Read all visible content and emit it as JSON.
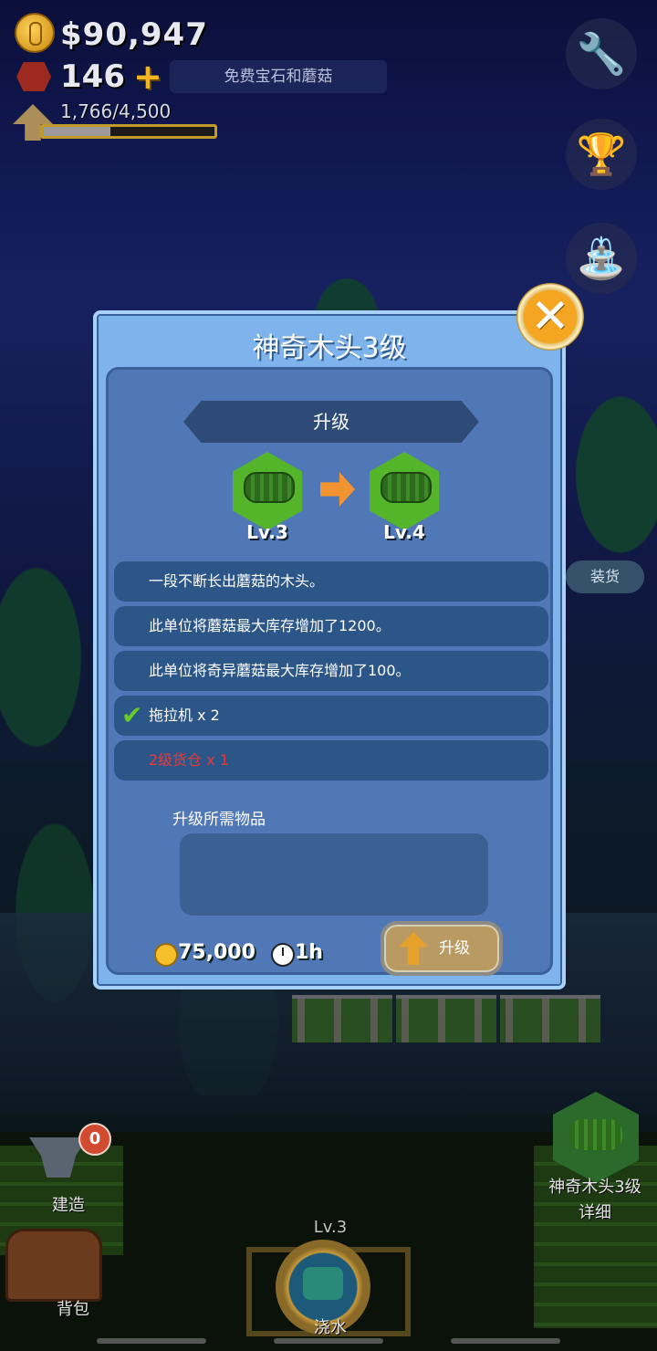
{
  "hud": {
    "money": "$90,947",
    "gems": "146",
    "plus": "+",
    "free_button": "免费宝石和蘑菇",
    "xp_text": "1,766/4,500",
    "xp_progress": 0.392
  },
  "dialog": {
    "title": "神奇木头3级",
    "close": "✕",
    "banner": "升级",
    "from_level": "Lv.3",
    "to_level": "Lv.4",
    "rows": [
      {
        "text": "一段不断长出蘑菇的木头。",
        "check": "",
        "red": false
      },
      {
        "text": "此单位将蘑菇最大库存增加了1200。",
        "check": "",
        "red": false
      },
      {
        "text": "此单位将奇异蘑菇最大库存增加了100。",
        "check": "",
        "red": false
      },
      {
        "text": "拖拉机 x 2",
        "check": "✔",
        "red": false
      },
      {
        "text": "2级货仓 x 1",
        "check": "",
        "red": true
      }
    ],
    "required_label": "升级所需物品",
    "cost": "75,000",
    "time": "1h",
    "upgrade_label": "升级"
  },
  "bottom": {
    "build_label": "建造",
    "build_badge": "0",
    "bag_label": "背包",
    "water_level": "Lv.3",
    "water_label": "浇水",
    "item_name": "神奇木头3级",
    "item_detail": "详细"
  },
  "world": {
    "shipping_label": "装货"
  },
  "colors": {
    "accent": "#f4a623",
    "dialog_bg": "#7eb3ec",
    "panel_bg": "#5178b6",
    "row_bg": "#2d5688",
    "error_text": "#e33b3b",
    "check": "#66cc2a"
  },
  "icons": {
    "settings": "wrench-icon",
    "trophy": "trophy-icon",
    "watering": "watering-can-icon"
  }
}
